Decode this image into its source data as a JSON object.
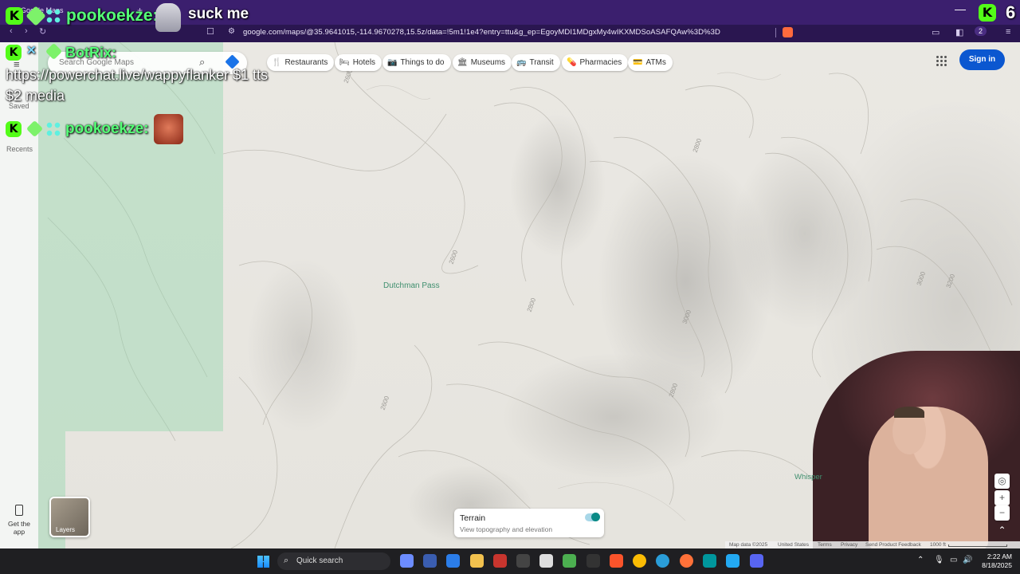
{
  "browser": {
    "tab_title": "Google Maps",
    "new_tab": "+",
    "minimize": "—",
    "back": "‹",
    "forward": "›",
    "reload": "↻",
    "url": "google.com/maps/@35.9641015,-114.9670278,15.5z/data=!5m1!1e4?entry=ttu&g_ep=EgoyMDI1MDgxMy4wIKXMDSoASAFQAw%3D%3D",
    "wallet_count": "2"
  },
  "maps": {
    "search_placeholder": "Search Google Maps",
    "rail": {
      "saved": "Saved",
      "recents": "Recents",
      "get_app": "Get the app"
    },
    "chips": [
      {
        "icon": "restaurant-icon",
        "glyph": "🍴",
        "label": "Restaurants"
      },
      {
        "icon": "hotel-icon",
        "glyph": "🛏",
        "label": "Hotels"
      },
      {
        "icon": "camera-icon",
        "glyph": "📷",
        "label": "Things to do"
      },
      {
        "icon": "museum-icon",
        "glyph": "🏛",
        "label": "Museums"
      },
      {
        "icon": "transit-icon",
        "glyph": "🚌",
        "label": "Transit"
      },
      {
        "icon": "pharmacy-icon",
        "glyph": "💊",
        "label": "Pharmacies"
      },
      {
        "icon": "atm-icon",
        "glyph": "💳",
        "label": "ATMs"
      }
    ],
    "sign_in": "Sign in",
    "place_labels": {
      "dutchman": "Dutchman Pass",
      "whisper": "Whisper"
    },
    "elevations": [
      "2600",
      "2800",
      "2600",
      "2800",
      "3000",
      "3000",
      "3200",
      "2600",
      "2800"
    ],
    "terrain": {
      "title": "Terrain",
      "subtitle": "View topography and elevation",
      "enabled": true
    },
    "layers_label": "Layers",
    "zoom_in": "+",
    "zoom_out": "−",
    "footer": {
      "map_data": "Map data ©2025",
      "country": "United States",
      "terms": "Terms",
      "privacy": "Privacy",
      "feedback": "Send Product Feedback",
      "scale": "1000 ft"
    }
  },
  "chat": {
    "msg1_user": "pookoekze:",
    "msg1_text": "suck me",
    "msg2_user": "BotRix:",
    "msg2_line1": "https://powerchat.live/wappyflanker $1 tts",
    "msg2_line2": "$2 media",
    "msg3_user": "pookoekze:",
    "badge_letter": "K",
    "viewer_count": "6"
  },
  "taskbar": {
    "search_label": "Quick search",
    "time": "2:22 AM",
    "date": "8/18/2025"
  }
}
